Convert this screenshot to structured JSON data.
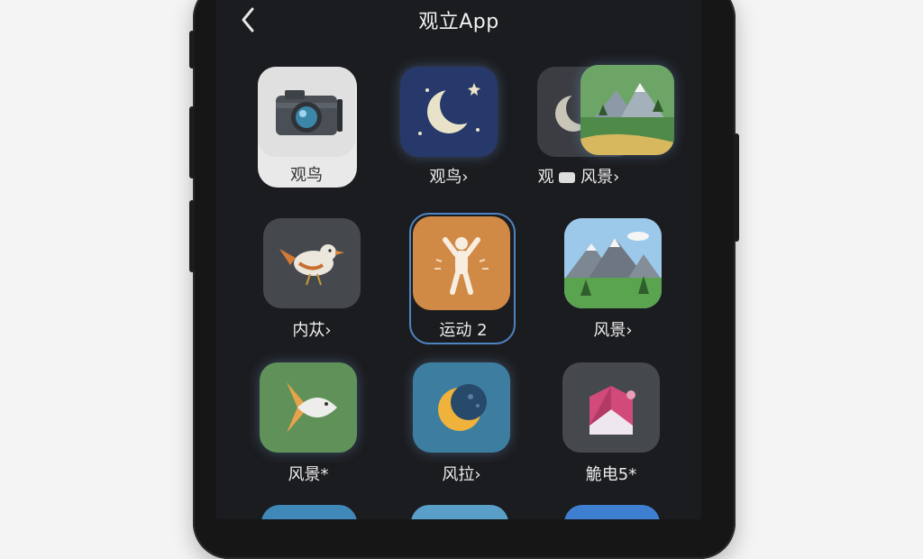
{
  "header": {
    "title": "观立App",
    "back_icon": "chevron-left-icon"
  },
  "apps": [
    {
      "label": "观鸟",
      "icon": "camera-icon"
    },
    {
      "label": "观鸟›",
      "icon": "moon-icon"
    },
    {
      "label": "观",
      "icon": "moon-icon",
      "overlay_label": "风景›",
      "overlay_icon": "mountain-landscape-icon"
    },
    {
      "label": "内苁›",
      "icon": "bird-icon"
    },
    {
      "label": "运动 2",
      "icon": "exercise-person-icon"
    },
    {
      "label": "风景›",
      "icon": "mountain-landscape-icon"
    },
    {
      "label": "风景*",
      "icon": "fish-icon"
    },
    {
      "label": "风拉›",
      "icon": "crescent-moon-icon"
    },
    {
      "label": "觤电5*",
      "icon": "pink-landmark-icon"
    }
  ],
  "colors": {
    "screen_bg": "#1b1c1f",
    "selection": "#4f84c2",
    "label": "#ececec"
  }
}
